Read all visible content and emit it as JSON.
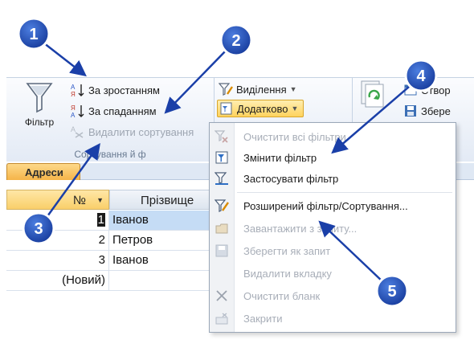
{
  "ribbon": {
    "filter_label": "Фільтр",
    "sort_asc": "За зростанням",
    "sort_desc": "За спаданням",
    "remove_sort": "Видалити сортування",
    "group_caption": "Сортування й ф",
    "selection": "Виділення",
    "dodatkovo": "Додатково",
    "create_partial": "Створ",
    "save_partial": "Збере",
    "other_partial": "Оновити"
  },
  "table": {
    "tab_label": "Адреси",
    "col_no": "№",
    "col_surname": "Прізвище",
    "rows": [
      {
        "no": "1",
        "surname": "Іванов"
      },
      {
        "no": "2",
        "surname": "Петров"
      },
      {
        "no": "3",
        "surname": "Іванов"
      }
    ],
    "new_row": "(Новий)"
  },
  "menu": {
    "items": [
      {
        "label": "Очистити всі фільтри",
        "icon": "clear-filter-icon"
      },
      {
        "label": "Змінити фільтр",
        "icon": "filter-form-icon"
      },
      {
        "label": "Застосувати фільтр",
        "icon": "apply-filter-icon"
      },
      {
        "label": "Розширений фільтр/Сортування...",
        "icon": "advanced-filter-icon"
      },
      {
        "label": "Завантажити з запиту...",
        "icon": "load-query-icon"
      },
      {
        "label": "Зберегти як запит",
        "icon": "save-query-icon"
      },
      {
        "label": "Видалити вкладку",
        "icon": ""
      },
      {
        "label": "Очистити бланк",
        "icon": "close-x-icon"
      },
      {
        "label": "Закрити",
        "icon": "close-pane-icon"
      }
    ]
  },
  "annotations": {
    "b1": "1",
    "b2": "2",
    "b3": "3",
    "b4": "4",
    "b5": "5"
  },
  "colors": {
    "badge": "#1f4fb5",
    "arrow": "#1a3fa8",
    "highlight": "#ffd35e"
  }
}
